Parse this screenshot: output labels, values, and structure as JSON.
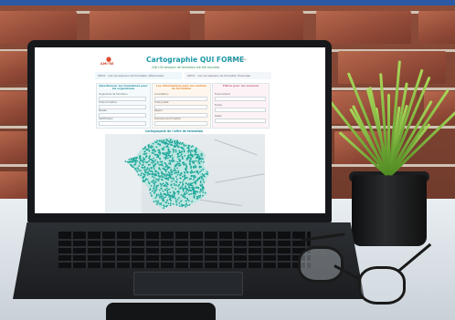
{
  "screen_page": {
    "logo_text": "AMI·RE",
    "title": "Cartographie QUI FORME",
    "header_link": "Mon compte",
    "count_line": "248 140 sessions de formation ont été trouvées",
    "info_left": "OPCO : voir les sessions de formation référencées",
    "info_right": "OPCO : voir les sessions de formation financées",
    "panel_left": {
      "heading": "Sélectionner les formations pour les organismes",
      "fields": [
        "Organisme de formation",
        "Code formation",
        "Niveau",
        "Certification"
      ]
    },
    "panel_middle": {
      "heading": "Les informations pour les centres de formation",
      "fields": [
        "Localisation",
        "Code postal",
        "Région",
        "Domaine de formation"
      ]
    },
    "panel_right": {
      "heading": "Filtres pour les sessions",
      "fields": [
        "Financement",
        "Durée",
        "Dates"
      ]
    },
    "map_caption": "Cartographie de l'offre de formation"
  },
  "colors": {
    "accent": "#1e9aa8",
    "map_dots": "#1fa79b",
    "top_bar": "#2b59a3"
  }
}
